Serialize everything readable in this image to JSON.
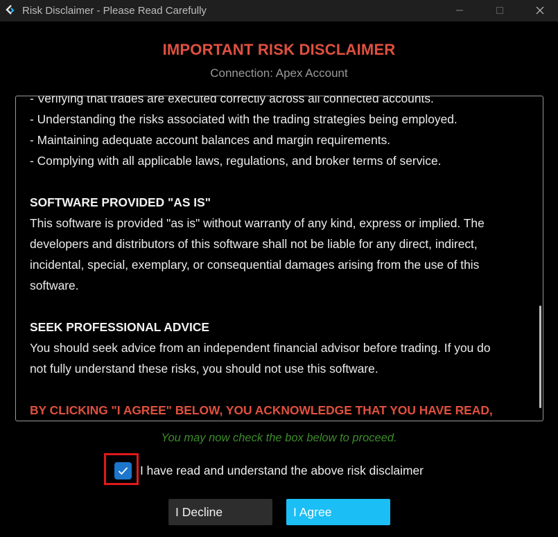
{
  "window": {
    "title": "Risk Disclaimer - Please Read Carefully",
    "controls": [
      "minimize-icon",
      "maximize-icon",
      "close-icon"
    ]
  },
  "header": {
    "title": "IMPORTANT RISK DISCLAIMER",
    "connection": "Connection: Apex Account"
  },
  "disclaimer": {
    "partial_top_line": "- Verifying that trades are executed correctly across all connected accounts.",
    "bullets": [
      "- Understanding the risks associated with the trading strategies being employed.",
      "- Maintaining adequate account balances and margin requirements.",
      "- Complying with all applicable laws, regulations, and broker terms of service."
    ],
    "software_heading": "SOFTWARE PROVIDED \"AS IS\"",
    "software_body_lines": [
      "This software is provided \"as is\" without warranty of any kind, express or implied. The",
      "developers and distributors of this software shall not be liable for any direct, indirect,",
      "incidental, special, exemplary, or consequential damages arising from the use of this",
      "software."
    ],
    "advice_heading": "SEEK PROFESSIONAL ADVICE",
    "advice_body_lines": [
      "You should seek advice from an independent financial advisor before trading. If you do",
      "not fully understand these risks, you should not use this software."
    ],
    "final_notice": "BY CLICKING \"I AGREE\" BELOW, YOU ACKNOWLEDGE THAT YOU HAVE READ,"
  },
  "proceed_note": "You may now check the box below to proceed.",
  "agreement": {
    "checked": true,
    "label": "I have read and understand the above risk disclaimer"
  },
  "buttons": {
    "decline": "I Decline",
    "agree": "I Agree"
  },
  "colors": {
    "heading": "#e0503f",
    "checkbox": "#1c76cc",
    "agree_button": "#1bbef5",
    "proceed_note": "#3d8c2c",
    "highlight": "#e0191c"
  }
}
